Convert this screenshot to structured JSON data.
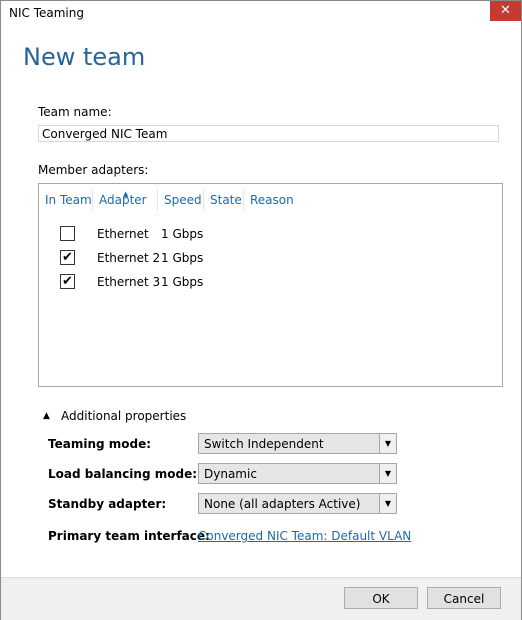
{
  "window": {
    "title": "NIC Teaming",
    "close_glyph": "✕"
  },
  "page": {
    "heading": "New team"
  },
  "team_name": {
    "label": "Team name:",
    "value": "Converged NIC Team"
  },
  "members": {
    "label": "Member adapters:",
    "columns": [
      "In Team",
      "Adapter",
      "Speed",
      "State",
      "Reason"
    ],
    "rows": [
      {
        "checked": false,
        "adapter": "Ethernet",
        "speed": "1 Gbps",
        "state": "",
        "reason": ""
      },
      {
        "checked": true,
        "adapter": "Ethernet 2",
        "speed": "1 Gbps",
        "state": "",
        "reason": ""
      },
      {
        "checked": true,
        "adapter": "Ethernet 3",
        "speed": "1 Gbps",
        "state": "",
        "reason": ""
      }
    ]
  },
  "additional": {
    "label": "Additional properties",
    "teaming_mode": {
      "label": "Teaming mode:",
      "value": "Switch Independent"
    },
    "load_balancing": {
      "label": "Load balancing mode:",
      "value": "Dynamic"
    },
    "standby": {
      "label": "Standby adapter:",
      "value": "None (all adapters Active)"
    },
    "primary_interface": {
      "label": "Primary team interface:",
      "link": "Converged NIC Team: Default VLAN"
    }
  },
  "buttons": {
    "ok": "OK",
    "cancel": "Cancel"
  },
  "colors": {
    "accent": "#2a6496",
    "link": "#1f6aa5",
    "close": "#c73a31"
  }
}
